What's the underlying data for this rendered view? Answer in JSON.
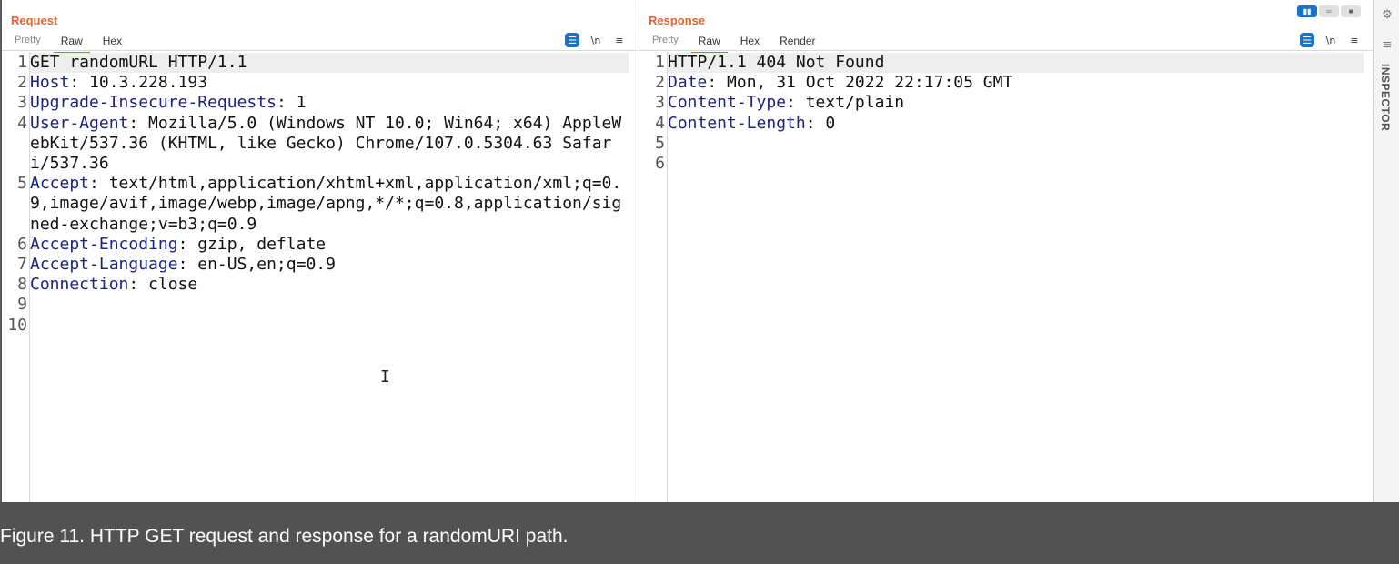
{
  "request": {
    "title": "Request",
    "tabs": [
      "Pretty",
      "Raw",
      "Hex"
    ],
    "active_tab": "Raw",
    "tools": [
      "wrap-toggle-icon",
      "newline-icon",
      "menu-icon"
    ],
    "tool_glyphs": {
      "newline": "\\n",
      "menu": "≡",
      "wrap": "☰"
    },
    "lines": [
      {
        "n": "1",
        "name": "",
        "sep": "",
        "value": "GET randomURL HTTP/1.1"
      },
      {
        "n": "2",
        "name": "Host",
        "sep": ": ",
        "value": "10.3.228.193"
      },
      {
        "n": "3",
        "name": "Upgrade-Insecure-Requests",
        "sep": ": ",
        "value": "1"
      },
      {
        "n": "4",
        "name": "User-Agent",
        "sep": ": ",
        "value": "Mozilla/5.0 (Windows NT 10.0; Win64; x64) AppleWebKit/537.36 (KHTML, like Gecko) Chrome/107.0.5304.63 Safari/537.36"
      },
      {
        "n": "5",
        "name": "Accept",
        "sep": ":",
        "value": " text/html,application/xhtml+xml,application/xml;q=0.9,image/avif,image/webp,image/apng,*/*;q=0.8,application/signed-exchange;v=b3;q=0.9"
      },
      {
        "n": "6",
        "name": "Accept-Encoding",
        "sep": ": ",
        "value": "gzip, deflate"
      },
      {
        "n": "7",
        "name": "Accept-Language",
        "sep": ": ",
        "value": "en-US,en;q=0.9"
      },
      {
        "n": "8",
        "name": "Connection",
        "sep": ": ",
        "value": "close"
      },
      {
        "n": "9",
        "name": "",
        "sep": "",
        "value": ""
      },
      {
        "n": "10",
        "name": "",
        "sep": "",
        "value": ""
      }
    ]
  },
  "response": {
    "title": "Response",
    "tabs": [
      "Pretty",
      "Raw",
      "Hex",
      "Render"
    ],
    "active_tab": "Raw",
    "lines": [
      {
        "n": "1",
        "name": "",
        "sep": "",
        "value": "HTTP/1.1 404 Not Found"
      },
      {
        "n": "2",
        "name": "Date",
        "sep": ": ",
        "value": "Mon, 31 Oct 2022 22:17:05 GMT"
      },
      {
        "n": "3",
        "name": "Content-Type",
        "sep": ": ",
        "value": "text/plain"
      },
      {
        "n": "4",
        "name": "Content-Length",
        "sep": ": ",
        "value": "0"
      },
      {
        "n": "5",
        "name": "",
        "sep": "",
        "value": ""
      },
      {
        "n": "6",
        "name": "",
        "sep": "",
        "value": ""
      }
    ]
  },
  "sidebar": {
    "label": "INSPECTOR",
    "icons": [
      "settings-icon",
      "collapse-icon"
    ]
  },
  "layout_toggle": [
    "side-by-side",
    "stacked",
    "single"
  ],
  "caption": "Figure 11. HTTP GET request and response for a randomURI path.",
  "colors": {
    "accent": "#e8622c",
    "header_name": "#1a237e",
    "tool_blue": "#1a73c8",
    "caption_bg": "#525252"
  }
}
